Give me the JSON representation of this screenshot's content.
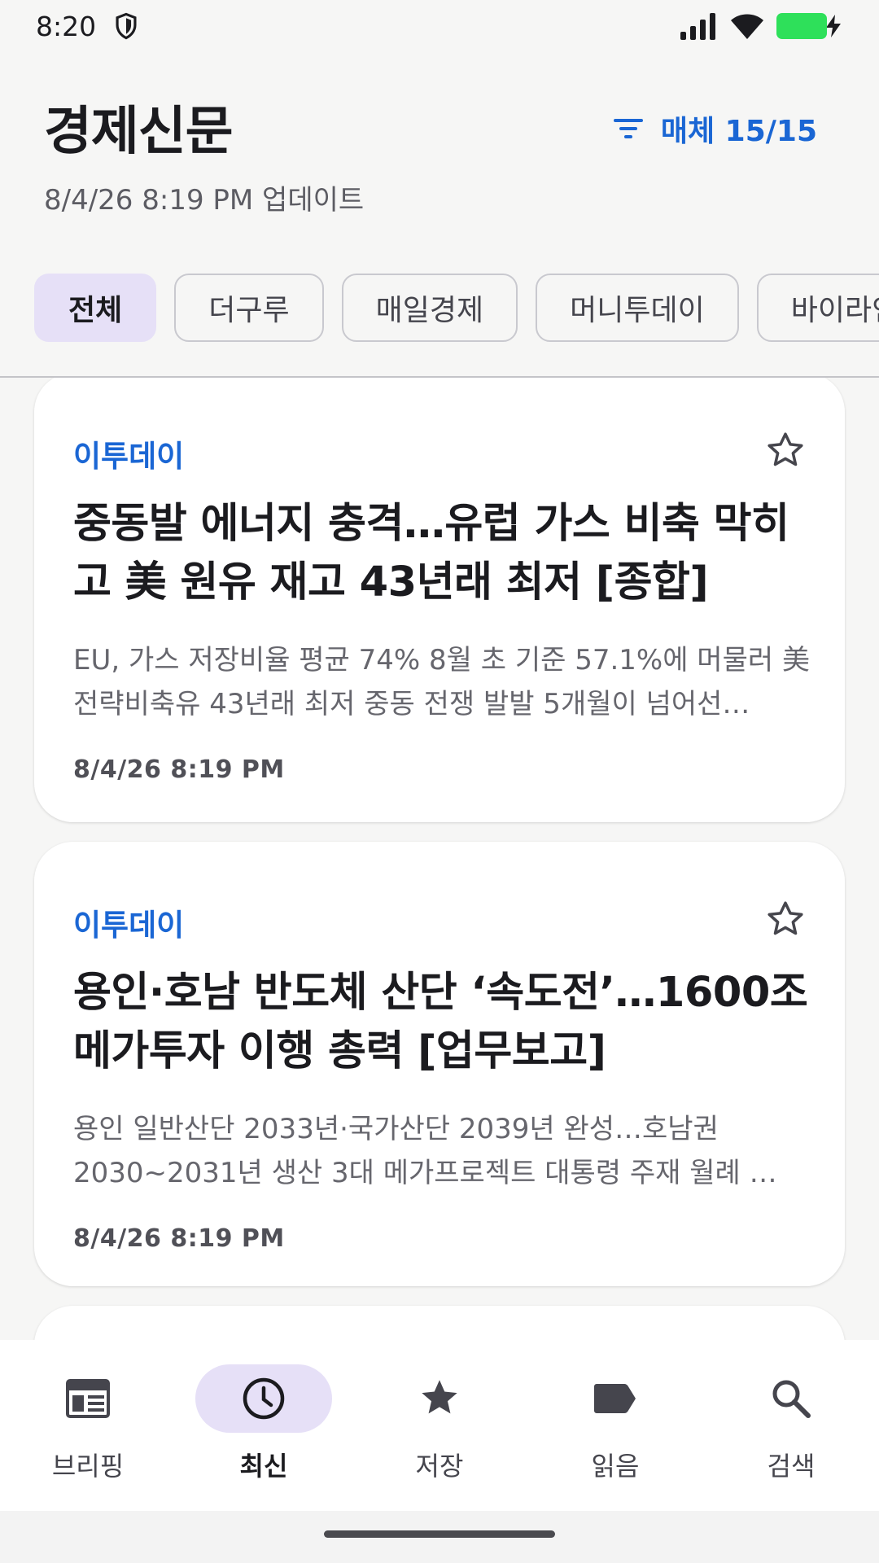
{
  "status_bar": {
    "time": "8:20"
  },
  "header": {
    "title": "경제신문",
    "updated": "8/4/26 8:19 PM 업데이트",
    "filter_label": "매체 15/15"
  },
  "chips": [
    {
      "label": "전체",
      "active": true
    },
    {
      "label": "더구루"
    },
    {
      "label": "매일경제"
    },
    {
      "label": "머니투데이"
    },
    {
      "label": "바이라인네트워크"
    }
  ],
  "articles": [
    {
      "source": "이투데이",
      "title": "중동발 에너지 충격…유럽 가스 비축 막히고 美 원유 재고 43년래 최저 [종합]",
      "summary": "EU, 가스 저장비율 평균 74% 8월 초 기준 57.1%에 머물러 美 전략비축유 43년래 최저 중동 전쟁 발발 5개월이 넘어선…",
      "date": "8/4/26 8:19 PM"
    },
    {
      "source": "이투데이",
      "title": "용인·호남 반도체 산단 ‘속도전’…1600조 메가투자 이행 총력 [업무보고]",
      "summary": "용인 일반산단 2033년·국가산단 2039년 완성…호남권 2030~2031년 생산 3대 메가프로젝트 대통령 주재 월례 …",
      "date": "8/4/26 8:19 PM"
    }
  ],
  "bottom_nav": [
    {
      "label": "브리핑",
      "icon": "briefing-icon"
    },
    {
      "label": "최신",
      "icon": "clock-icon",
      "active": true
    },
    {
      "label": "저장",
      "icon": "star-icon"
    },
    {
      "label": "읽음",
      "icon": "label-icon"
    },
    {
      "label": "검색",
      "icon": "search-icon"
    }
  ],
  "colors": {
    "accent": "#1a66d4",
    "chip_active": "#e6e0f7",
    "battery": "#2ee05a"
  }
}
